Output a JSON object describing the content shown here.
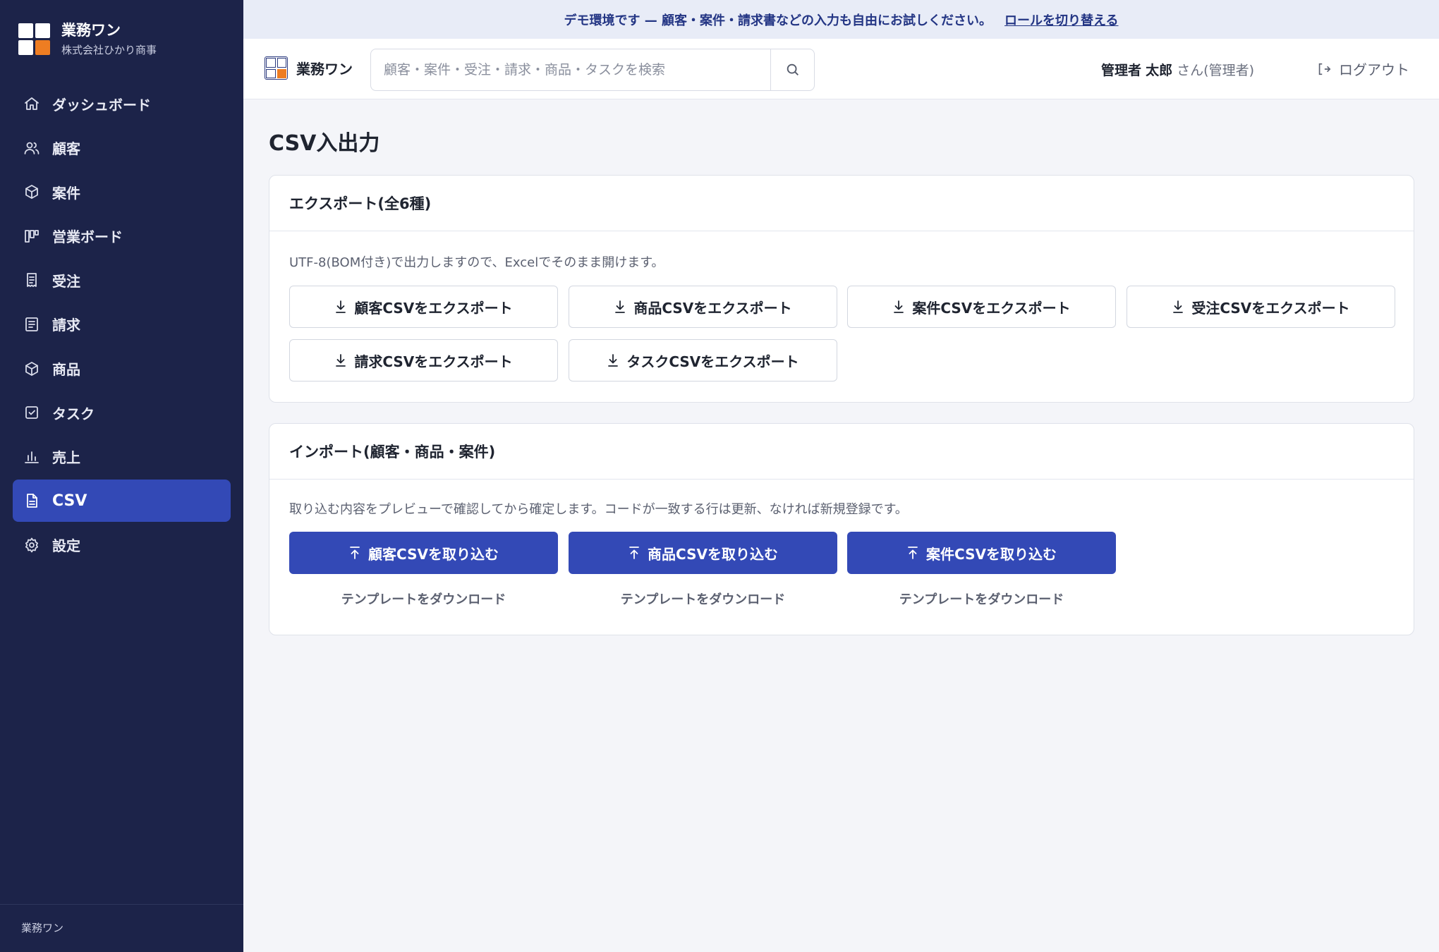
{
  "app": {
    "name": "業務ワン",
    "company": "株式会社ひかり商事",
    "footer": "業務ワン",
    "accent": "#3349b6",
    "sidebar_bg": "#1c2349",
    "logo_accent": "#ee7d22"
  },
  "sidebar": {
    "items": [
      {
        "label": "ダッシュボード",
        "icon": "home-icon"
      },
      {
        "label": "顧客",
        "icon": "users-icon"
      },
      {
        "label": "案件",
        "icon": "box-icon"
      },
      {
        "label": "営業ボード",
        "icon": "kanban-icon"
      },
      {
        "label": "受注",
        "icon": "receipt-icon"
      },
      {
        "label": "請求",
        "icon": "document-icon"
      },
      {
        "label": "商品",
        "icon": "package-icon"
      },
      {
        "label": "タスク",
        "icon": "checkbox-icon"
      },
      {
        "label": "売上",
        "icon": "bar-chart-icon"
      },
      {
        "label": "CSV",
        "icon": "file-icon",
        "active": true
      },
      {
        "label": "設定",
        "icon": "gear-icon"
      }
    ]
  },
  "banner": {
    "text": "デモ環境です — 顧客・案件・請求書などの入力も自由にお試しください。",
    "link": "ロールを切り替える"
  },
  "header": {
    "brand": "業務ワン",
    "search_placeholder": "顧客・案件・受注・請求・商品・タスクを検索",
    "user_role_label": "管理者",
    "user_name": "太郎",
    "user_suffix": "さん(管理者)",
    "logout": "ログアウト"
  },
  "main": {
    "title": "CSV入出力",
    "export": {
      "heading": "エクスポート(全6種)",
      "description": "UTF-8(BOM付き)で出力しますので、Excelでそのまま開けます。",
      "buttons": [
        "顧客CSVをエクスポート",
        "商品CSVをエクスポート",
        "案件CSVをエクスポート",
        "受注CSVをエクスポート",
        "請求CSVをエクスポート",
        "タスクCSVをエクスポート"
      ]
    },
    "import": {
      "heading": "インポート(顧客・商品・案件)",
      "description": "取り込む内容をプレビューで確認してから確定します。コードが一致する行は更新、なければ新規登録です。",
      "buttons": [
        "顧客CSVを取り込む",
        "商品CSVを取り込む",
        "案件CSVを取り込む"
      ],
      "template_link": "テンプレートをダウンロード"
    }
  }
}
